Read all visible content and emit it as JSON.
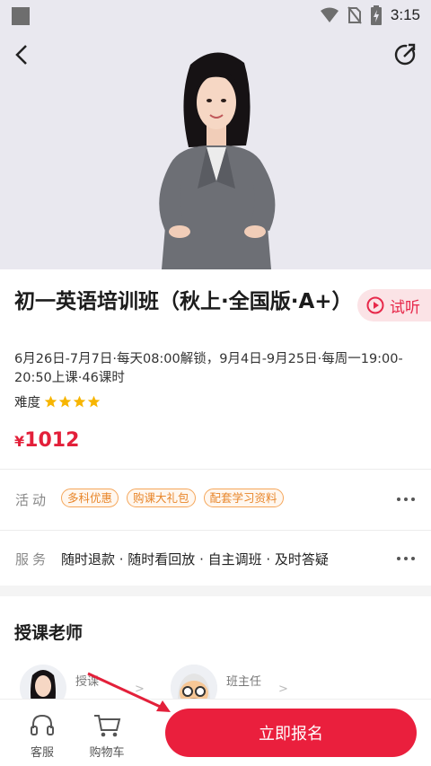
{
  "status_bar": {
    "time": "3:15"
  },
  "course": {
    "title": "初一英语培训班（秋上·全国版·A+）",
    "schedule": "6月26日-7月7日·每天08:00解锁，9月4日-9月25日·每周一19:00-20:50上课·46课时",
    "difficulty_label": "难度",
    "difficulty_stars": 4,
    "price_symbol": "¥",
    "price": "1012",
    "trial_label": "试听"
  },
  "activity": {
    "label": "活动",
    "tags": [
      "多科优惠",
      "购课大礼包",
      "配套学习资料"
    ]
  },
  "service": {
    "label": "服务",
    "text": "随时退款 · 随时看回放 · 自主调班 · 及时答疑"
  },
  "teachers_section": {
    "title": "授课老师",
    "teachers": [
      {
        "role": "授课"
      },
      {
        "role": "班主任"
      }
    ]
  },
  "bottom_bar": {
    "service_label": "客服",
    "cart_label": "购物车",
    "signup_label": "立即报名"
  },
  "colors": {
    "accent_red": "#ea1f3d",
    "price_red": "#e3203a",
    "tag_orange": "#e8862a",
    "star_yellow": "#f7b500"
  }
}
